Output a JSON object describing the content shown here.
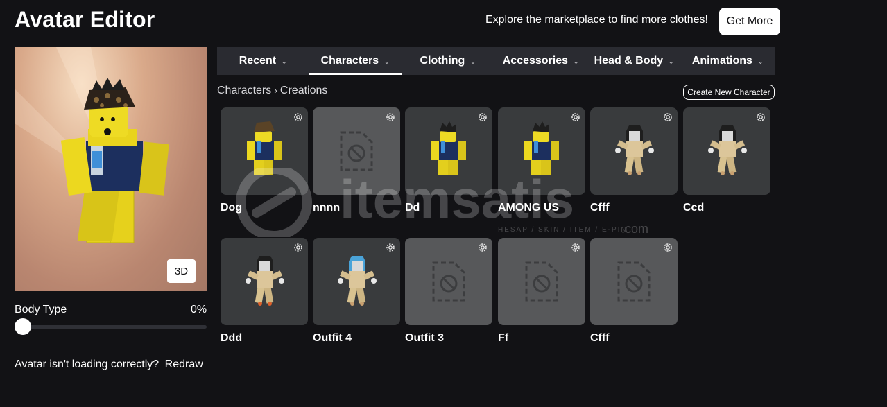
{
  "header": {
    "title": "Avatar Editor",
    "promo_text": "Explore the marketplace to find more clothes!",
    "get_more_label": "Get More"
  },
  "preview": {
    "view_toggle_label": "3D"
  },
  "body_type": {
    "label": "Body Type",
    "value_text": "0%",
    "value": 0
  },
  "redraw": {
    "message": "Avatar isn't loading correctly?",
    "link_label": "Redraw"
  },
  "tabs": [
    {
      "label": "Recent",
      "active": false
    },
    {
      "label": "Characters",
      "active": true
    },
    {
      "label": "Clothing",
      "active": false
    },
    {
      "label": "Accessories",
      "active": false
    },
    {
      "label": "Head & Body",
      "active": false
    },
    {
      "label": "Animations",
      "active": false
    }
  ],
  "breadcrumb": {
    "parent": "Characters",
    "current": "Creations"
  },
  "create_button_label": "Create New Character",
  "characters": [
    {
      "name": "Dog",
      "thumb": "yellow-avatar-hat"
    },
    {
      "name": "nnnn",
      "thumb": "empty"
    },
    {
      "name": "Dd",
      "thumb": "yellow-avatar-hair"
    },
    {
      "name": "AMONG US",
      "thumb": "yellow-avatar-hair"
    },
    {
      "name": "Cfff",
      "thumb": "zombie-avatar"
    },
    {
      "name": "Ccd",
      "thumb": "zombie-avatar"
    },
    {
      "name": "Ddd",
      "thumb": "zombie-avatar-red"
    },
    {
      "name": "Outfit 4",
      "thumb": "zombie-avatar-blue"
    },
    {
      "name": "Outfit 3",
      "thumb": "empty"
    },
    {
      "name": "Ff",
      "thumb": "empty"
    },
    {
      "name": "Cfff",
      "thumb": "empty"
    }
  ],
  "watermark": {
    "text": "itemsatis",
    "subtext": "HESAP / SKIN / ITEM / E-PIN",
    "suffix": ".com"
  },
  "colors": {
    "background": "#121215",
    "tab_bar": "#2a2b31",
    "card": "#393b3d",
    "card_empty": "#57585a"
  }
}
